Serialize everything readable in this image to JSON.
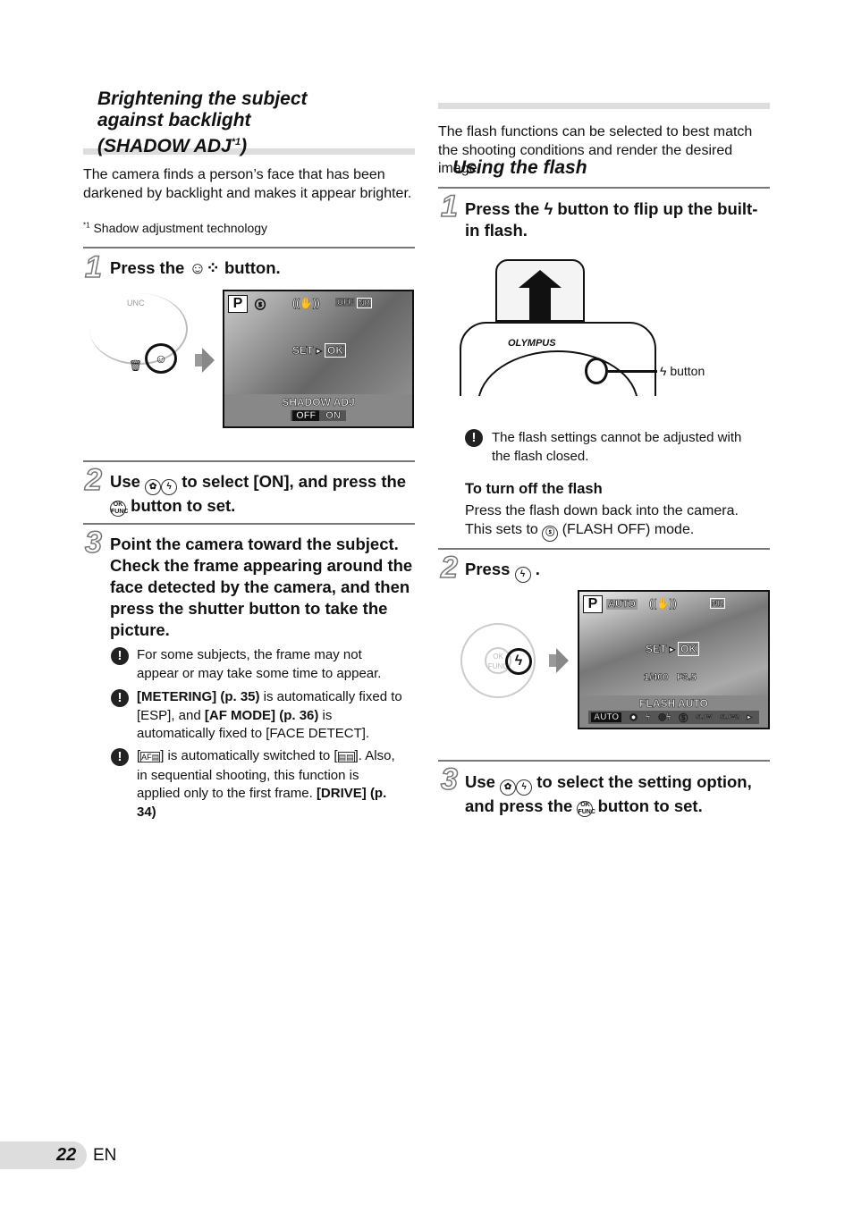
{
  "left": {
    "heading_lines": [
      "Brightening the subject",
      "against backlight",
      "(SHADOW ADJ"
    ],
    "heading_sup": "*1",
    "heading_close": ")",
    "intro": "The camera finds a person’s face that has been darkened by backlight and makes it appear brighter.",
    "footnote_mark": "*1",
    "footnote": "Shadow adjustment technology",
    "step1": {
      "num": "1",
      "pre": "Press the",
      "icon": "shadow-adj-icon",
      "post": "button."
    },
    "lcd1": {
      "mode": "P",
      "off": "OFF",
      "nr": "NR",
      "set": "SET",
      "ok": "OK",
      "bar_title": "SHADOW ADJ",
      "options": [
        "OFF",
        "ON"
      ],
      "selected": "OFF"
    },
    "dial1": {
      "func": "UNC"
    },
    "step2": {
      "num": "2",
      "pre": "Use",
      "mid": "to select [ON], and press the",
      "post": "button to set."
    },
    "step3": {
      "num": "3",
      "text": "Point the camera toward the subject. Check the frame appearing around the face detected by the camera, and then press the shutter button to take the picture."
    },
    "notes": [
      {
        "text": "For some subjects, the frame may not appear or may take some time to appear."
      },
      {
        "b1": "[METERING] (p. 35)",
        "t1": " is automatically fixed to [ESP], and ",
        "b2": "[AF MODE] (p. 36)",
        "t2": " is automatically fixed to [FACE DETECT]."
      },
      {
        "t1": "[",
        "t2": "] is automatically switched to [",
        "t3": "]. Also, in sequential shooting, this function is applied only to the first frame. ",
        "b1": "[DRIVE] (p. 34)"
      }
    ]
  },
  "right": {
    "heading": "Using the flash",
    "intro": "The flash functions can be selected to best match the shooting conditions and render the desired image.",
    "step1": {
      "num": "1",
      "pre": "Press the",
      "post": "button to flip up the built-in flash."
    },
    "camera": {
      "brand": "OLYMPUS",
      "callout": "button"
    },
    "warn": "The flash settings cannot be adjusted with the flash closed.",
    "turnoff_title": "To turn off the flash",
    "turnoff_l1": "Press the flash down back into the camera.",
    "turnoff_l2a": "This sets to",
    "turnoff_l2b": "(FLASH OFF) mode.",
    "step2": {
      "num": "2",
      "pre": "Press",
      "post": "."
    },
    "lcd2": {
      "mode": "P",
      "auto": "AUTO",
      "nr": "NR",
      "set": "SET",
      "ok": "OK",
      "shutter": "1/400",
      "aperture": "F3.5",
      "bar_title": "FLASH AUTO",
      "options": [
        "AUTO",
        "◉",
        "ϟ",
        "◎ϟ",
        "Ⓢ",
        "SLOW",
        "SLOW2",
        "▸"
      ]
    },
    "step3": {
      "num": "3",
      "pre": "Use",
      "post": "to select the setting option, and press the",
      "post2": "button to set."
    }
  },
  "footer": {
    "page": "22",
    "lang": "EN"
  },
  "colors": {
    "bar": "#dddddd",
    "rule": "#777777"
  }
}
